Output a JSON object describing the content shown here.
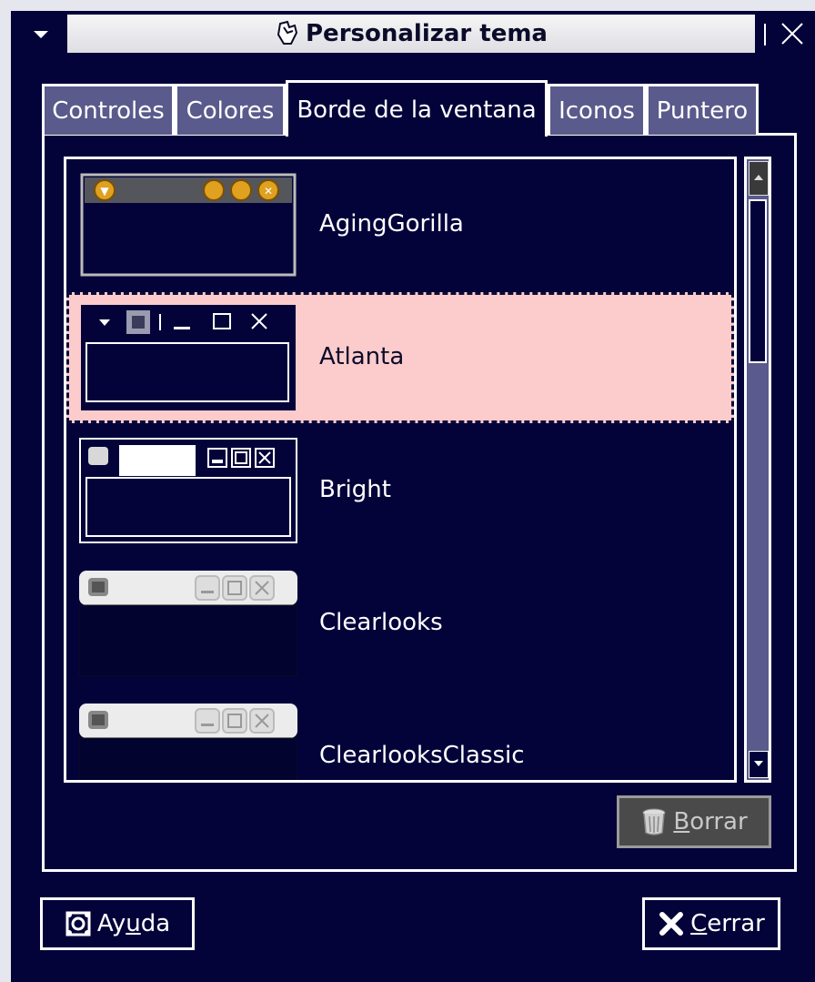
{
  "window": {
    "title": "Personalizar tema"
  },
  "tabs": [
    {
      "label": "Controles"
    },
    {
      "label": "Colores"
    },
    {
      "label": "Borde de la ventana"
    },
    {
      "label": "Iconos"
    },
    {
      "label": "Puntero"
    }
  ],
  "active_tab": "Borde de la ventana",
  "themes": [
    {
      "name": "AgingGorilla"
    },
    {
      "name": "Atlanta"
    },
    {
      "name": "Bright"
    },
    {
      "name": "Clearlooks"
    },
    {
      "name": "ClearlooksClassic"
    }
  ],
  "selected_theme": "Atlanta",
  "buttons": {
    "delete": {
      "pre": "",
      "key": "B",
      "post": "orrar"
    },
    "help": {
      "pre": "Ay",
      "key": "u",
      "post": "da"
    },
    "close": {
      "pre": "",
      "key": "C",
      "post": "errar"
    }
  },
  "colors": {
    "background": "#03033a",
    "tab_inactive": "#5a5a8c",
    "selection": "#fccccc"
  }
}
